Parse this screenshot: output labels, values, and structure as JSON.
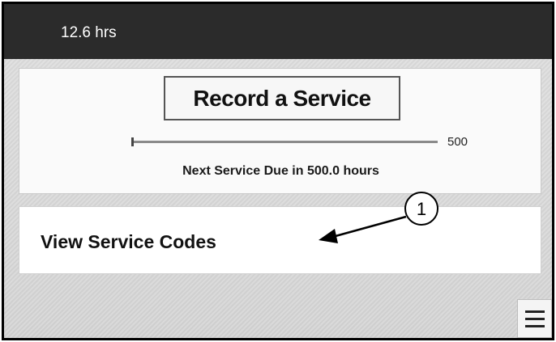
{
  "header": {
    "hours": "12.6 hrs"
  },
  "service_card": {
    "record_button_label": "Record a Service",
    "progress_max_label": "500",
    "progress_fraction": 0.0,
    "next_due_text": "Next Service Due in 500.0 hours"
  },
  "codes_card": {
    "label": "View Service Codes"
  },
  "callout": {
    "number": "1"
  },
  "colors": {
    "header_bg": "#2b2b2b",
    "page_bg": "#d9d9d9",
    "card_bg": "#fafafa",
    "text": "#111111"
  },
  "icons": {
    "menu": "hamburger-menu-icon"
  }
}
